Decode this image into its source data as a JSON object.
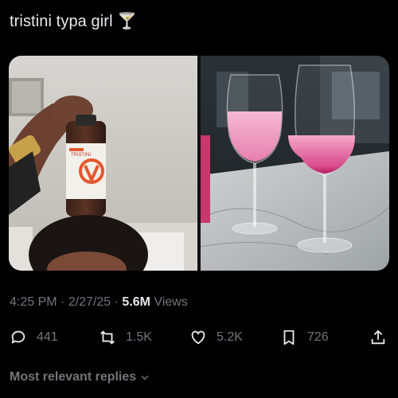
{
  "post": {
    "text": "tristini typa girl 🍸"
  },
  "meta": {
    "time": "4:25 PM",
    "sep1": " · ",
    "date": "2/27/25",
    "sep2": " · ",
    "views_count": "5.6M",
    "views_label": " Views"
  },
  "actions": {
    "replies": "441",
    "reposts": "1.5K",
    "likes": "5.2K",
    "bookmarks": "726"
  },
  "media": {
    "bottle_label": "TRISTINI"
  },
  "footer": {
    "replies_sort": "Most relevant replies"
  },
  "colors": {
    "background": "#000000",
    "text": "#e7e9ea",
    "muted": "#71767b",
    "drink_pink": "#f2a6c8"
  }
}
